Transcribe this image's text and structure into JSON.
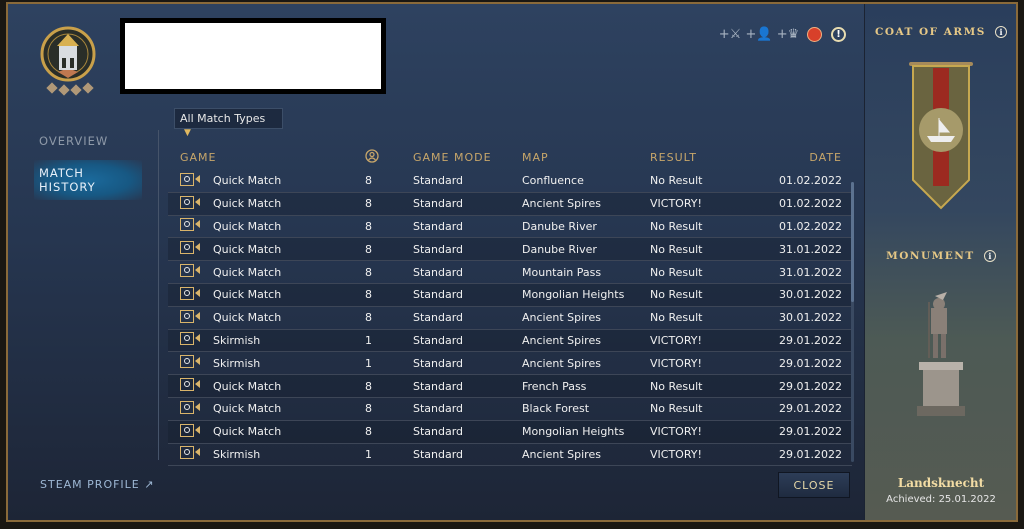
{
  "header": {
    "top_icons": [
      {
        "name": "add-sword-icon",
        "glyph": "+⚔"
      },
      {
        "name": "add-friend-icon",
        "glyph": "+👤"
      },
      {
        "name": "add-party-icon",
        "glyph": "+♛"
      },
      {
        "name": "block-icon",
        "glyph": "⊘"
      },
      {
        "name": "report-icon",
        "glyph": "!"
      }
    ]
  },
  "nav": {
    "items": [
      {
        "label": "OVERVIEW",
        "active": false
      },
      {
        "label": "MATCH HISTORY",
        "active": true
      }
    ],
    "steam_profile": "STEAM PROFILE",
    "external_glyph": "↗"
  },
  "filter": {
    "selected": "All Match Types",
    "caret": "▼"
  },
  "table": {
    "headers": {
      "game": "GAME",
      "players_icon": "player-count-icon",
      "mode": "GAME MODE",
      "map": "MAP",
      "result": "RESULT",
      "date": "DATE"
    },
    "rows": [
      {
        "game": "Quick Match",
        "players": "8",
        "mode": "Standard",
        "map": "Confluence",
        "result": "No Result",
        "date": "01.02.2022"
      },
      {
        "game": "Quick Match",
        "players": "8",
        "mode": "Standard",
        "map": "Ancient Spires",
        "result": "VICTORY!",
        "date": "01.02.2022"
      },
      {
        "game": "Quick Match",
        "players": "8",
        "mode": "Standard",
        "map": "Danube River",
        "result": "No Result",
        "date": "01.02.2022"
      },
      {
        "game": "Quick Match",
        "players": "8",
        "mode": "Standard",
        "map": "Danube River",
        "result": "No Result",
        "date": "31.01.2022"
      },
      {
        "game": "Quick Match",
        "players": "8",
        "mode": "Standard",
        "map": "Mountain Pass",
        "result": "No Result",
        "date": "31.01.2022"
      },
      {
        "game": "Quick Match",
        "players": "8",
        "mode": "Standard",
        "map": "Mongolian Heights",
        "result": "No Result",
        "date": "30.01.2022"
      },
      {
        "game": "Quick Match",
        "players": "8",
        "mode": "Standard",
        "map": "Ancient Spires",
        "result": "No Result",
        "date": "30.01.2022"
      },
      {
        "game": "Skirmish",
        "players": "1",
        "mode": "Standard",
        "map": "Ancient Spires",
        "result": "VICTORY!",
        "date": "29.01.2022"
      },
      {
        "game": "Skirmish",
        "players": "1",
        "mode": "Standard",
        "map": "Ancient Spires",
        "result": "VICTORY!",
        "date": "29.01.2022"
      },
      {
        "game": "Quick Match",
        "players": "8",
        "mode": "Standard",
        "map": "French Pass",
        "result": "No Result",
        "date": "29.01.2022"
      },
      {
        "game": "Quick Match",
        "players": "8",
        "mode": "Standard",
        "map": "Black Forest",
        "result": "No Result",
        "date": "29.01.2022"
      },
      {
        "game": "Quick Match",
        "players": "8",
        "mode": "Standard",
        "map": "Mongolian Heights",
        "result": "VICTORY!",
        "date": "29.01.2022"
      },
      {
        "game": "Skirmish",
        "players": "1",
        "mode": "Standard",
        "map": "Ancient Spires",
        "result": "VICTORY!",
        "date": "29.01.2022"
      }
    ]
  },
  "close_button": "CLOSE",
  "side_panel": {
    "coat_of_arms_title": "COAT OF ARMS",
    "monument_title": "MONUMENT",
    "info_glyph": "i",
    "monument_name": "Landsknecht",
    "achieved": "Achieved: 25.01.2022"
  },
  "colors": {
    "accent_gold": "#c7a66a",
    "active_nav": "#1b6a9c",
    "banner_red": "#9c2a20",
    "banner_olive": "#6a6440"
  }
}
